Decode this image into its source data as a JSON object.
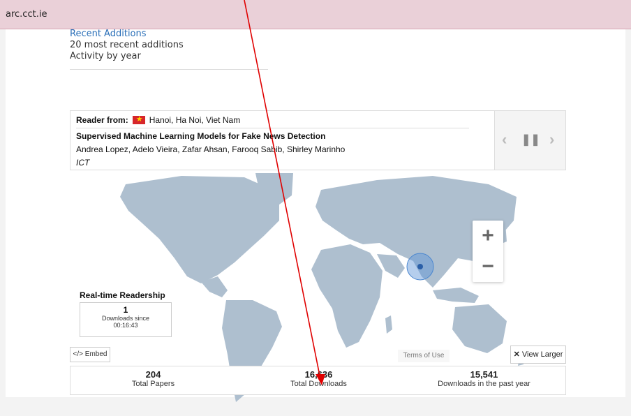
{
  "browser": {
    "host": "arc.cct.ie"
  },
  "links": {
    "recent": "Recent Additions",
    "twenty": "20 most recent additions",
    "activity": "Activity by year"
  },
  "reader": {
    "label": "Reader from:",
    "location": "Hanoi, Ha Noi, Viet Nam",
    "title": "Supervised Machine Learning Models for Fake News Detection",
    "authors": "Andrea Lopez, Adelo Vieira, Zafar Ahsan, Farooq Sabib, Shirley Marinho",
    "collection": "ICT"
  },
  "controls": {
    "prev": "‹",
    "pause": "❚❚",
    "next": "›"
  },
  "zoom": {
    "in": "+",
    "out": "−"
  },
  "realtime": {
    "label": "Real-time Readership",
    "count": "1",
    "since": "Downloads since",
    "time": "00:16:43"
  },
  "buttons": {
    "embed": "</> Embed",
    "terms": "Terms of Use",
    "larger": "View Larger"
  },
  "stats": [
    {
      "value": "204",
      "label": "Total Papers"
    },
    {
      "value": "16,636",
      "label": "Total Downloads"
    },
    {
      "value": "15,541",
      "label": "Downloads in the past year"
    }
  ],
  "colors": {
    "land": "#aebfcf",
    "accent": "#2a6fb8",
    "arrow": "#e00000",
    "topbar": "#ead0d8"
  }
}
